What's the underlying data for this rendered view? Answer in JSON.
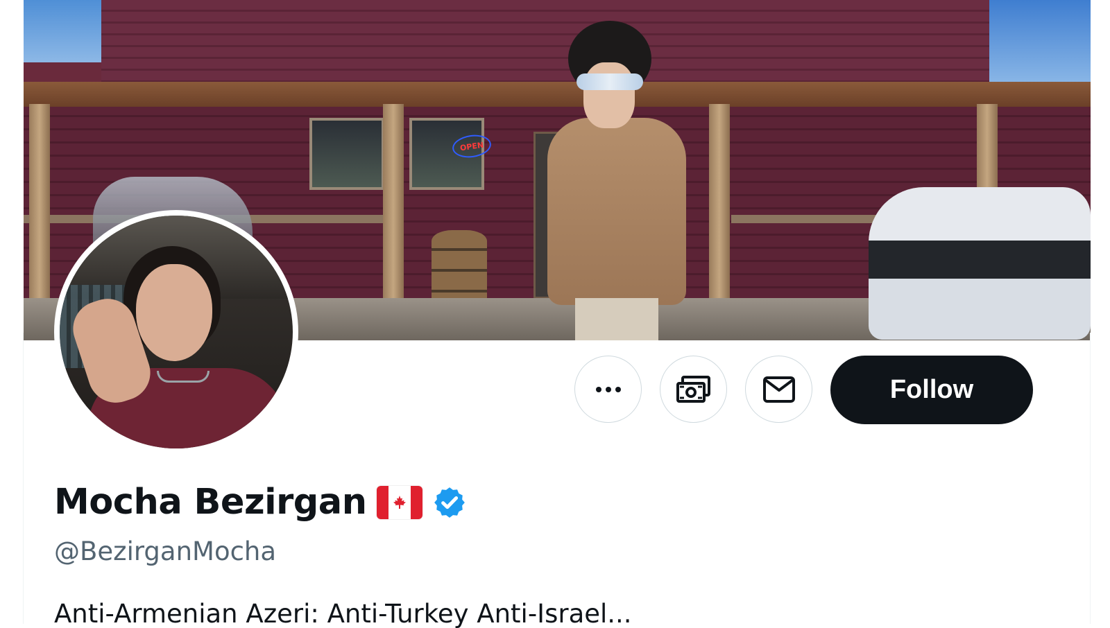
{
  "profile": {
    "display_name": "Mocha Bezirgan",
    "handle": "@BezirganMocha",
    "verified": true,
    "flag_emoji": "🇨🇦",
    "bio_partial": "Anti-Armenian Azeri: Anti-Turkey Anti-Israel..."
  },
  "banner": {
    "sign_text": "OPEN"
  },
  "actions": {
    "more_icon": "more-horizontal-icon",
    "tip_icon": "money-icon",
    "message_icon": "envelope-icon",
    "follow_label": "Follow"
  },
  "colors": {
    "follow_bg": "#0f1419",
    "verified_blue": "#1d9bf0",
    "handle_gray": "#536471",
    "border": "#cfd9de"
  }
}
